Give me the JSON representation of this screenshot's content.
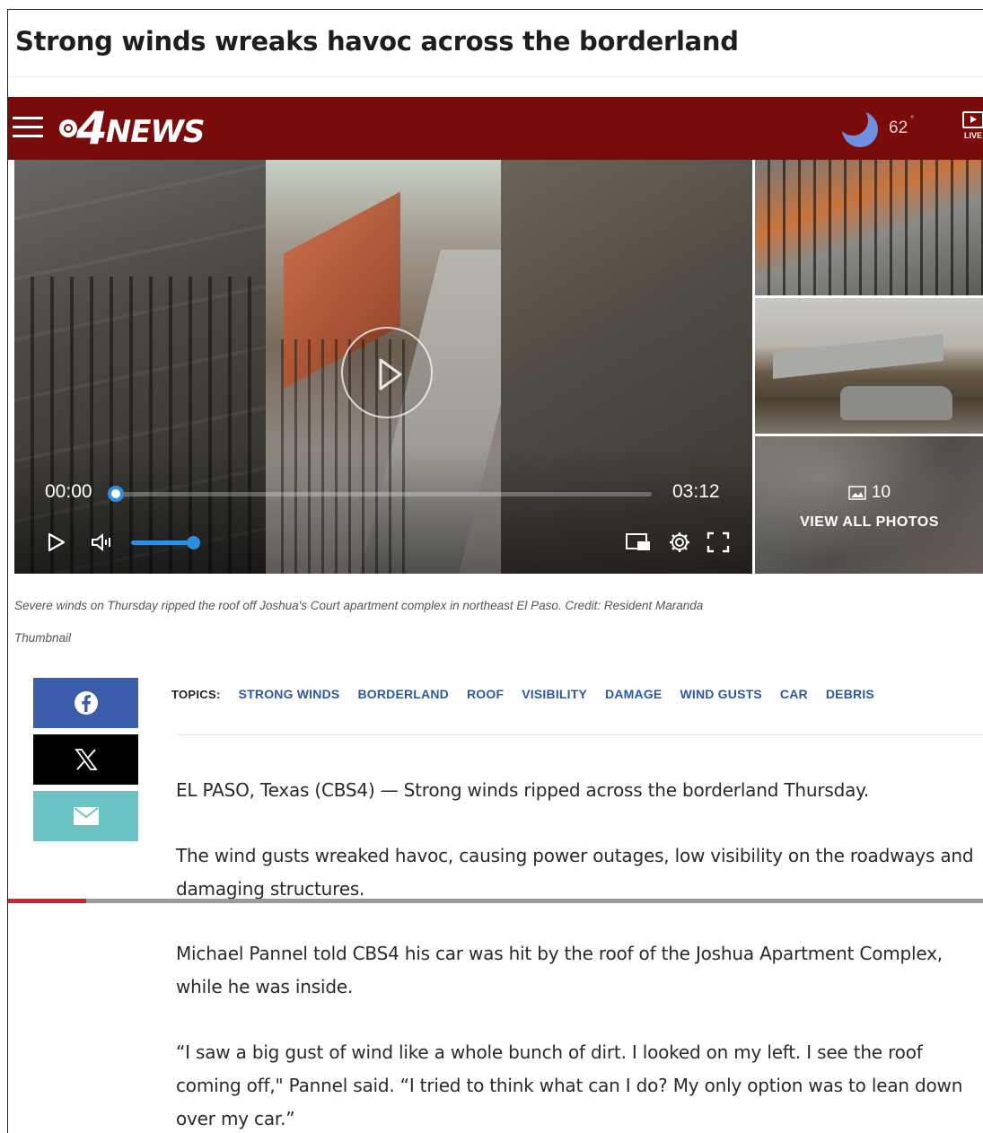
{
  "article": {
    "headline": "Strong winds wreaks havoc across the borderland",
    "caption_line1": "Severe winds on Thursday ripped the roof off Joshua's Court apartment complex in northeast El Paso. Credit: Resident Maranda",
    "caption_line2": "Thumbnail",
    "paragraphs": [
      "EL PASO, Texas (CBS4) — Strong winds ripped across the borderland Thursday.",
      "The wind gusts wreaked havoc, causing power outages, low visibility on the roadways and damaging structures.",
      "Michael Pannel told CBS4 his car was hit by the roof of the Joshua Apartment Complex, while he was inside.",
      "“I saw a big gust of wind like a whole bunch of dirt. I looked on my left. I see the roof coming off,\" Pannel said. “I tried to think what can I do? My only option was to lean down over my car.”"
    ]
  },
  "navbar": {
    "logo_number": "4",
    "logo_text": "NEWS",
    "temperature": "62",
    "temp_unit": "°",
    "live_label": "LIVE",
    "bg_color": "#7a0b0b"
  },
  "video": {
    "current_time": "00:00",
    "duration": "03:12",
    "progress_fraction": 0.0,
    "volume_fraction": 1.0,
    "accent_color": "#2f8ee0"
  },
  "gallery": {
    "photo_count": "10",
    "view_all_label": "VIEW ALL PHOTOS"
  },
  "topics": {
    "label": "TOPICS:",
    "items": [
      "STRONG WINDS",
      "BORDERLAND",
      "ROOF",
      "VISIBILITY",
      "DAMAGE",
      "WIND GUSTS",
      "CAR",
      "DEBRIS"
    ]
  },
  "share": {
    "facebook_icon": "facebook-icon",
    "x_icon": "x-icon",
    "email_icon": "envelope-icon",
    "facebook_color": "#3b5ca8",
    "x_color": "#000000",
    "email_color": "#6cc3c3"
  },
  "reading_progress": 0.08
}
